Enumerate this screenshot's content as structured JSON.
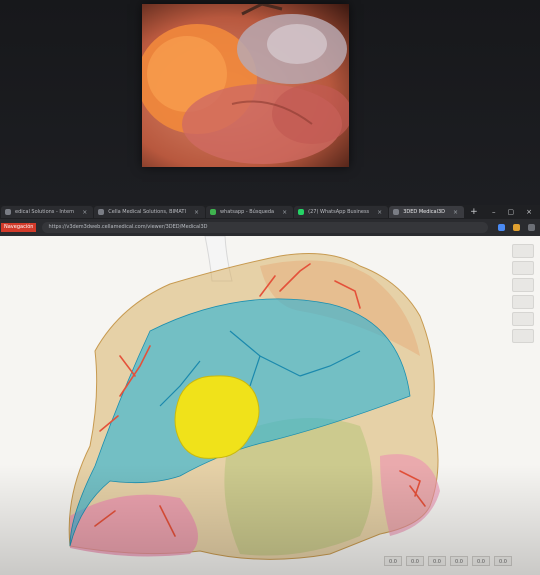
{
  "video": {
    "label": "laparoscopic-camera-feed"
  },
  "browser": {
    "tabs": [
      {
        "title": "edical Solutions - Intern",
        "fav": "doc",
        "active": false
      },
      {
        "title": "Cella Medical Solutions, BIMATI",
        "fav": "doc",
        "active": false
      },
      {
        "title": "whatsapp - Búsqueda",
        "fav": "search",
        "active": false
      },
      {
        "title": "(27) WhatsApp Business",
        "fav": "whatsapp",
        "active": false
      },
      {
        "title": "3DED Medical3D",
        "fav": "doc",
        "active": true
      }
    ],
    "new_tab_label": "+",
    "address": {
      "badge": "Navegación",
      "url": "https://v3dem3dweb.cellamedical.com/viewer/3DED/Medical3D"
    }
  },
  "viewer": {
    "tools": [
      "tool-1",
      "tool-2",
      "tool-3",
      "tool-4",
      "tool-5",
      "tool-6"
    ],
    "pager": [
      "0.0",
      "0.0",
      "0.0",
      "0.0",
      "0.0",
      "0.0"
    ]
  },
  "colors": {
    "lung": "#d8b26a",
    "airway": "#2bb3d6",
    "tumor": "#f0e21a",
    "vessels": "#e4513a",
    "lobe_pink": "#ec8fb0",
    "trachea": "#f4f4f4"
  }
}
